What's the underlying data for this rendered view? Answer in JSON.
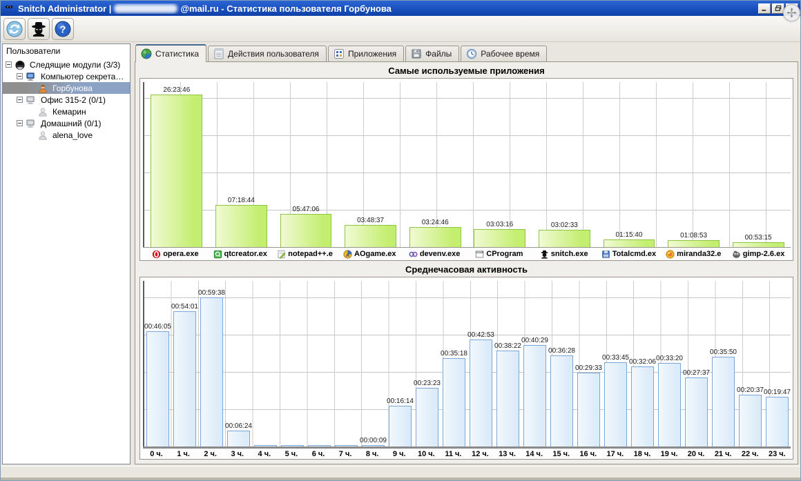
{
  "window": {
    "title_prefix": "Snitch Administrator |",
    "title_suffix": "@mail.ru - Статистика пользователя Горбунова",
    "controls": [
      {
        "name": "minimize"
      },
      {
        "name": "restore"
      },
      {
        "name": "close"
      }
    ]
  },
  "toolbar": {
    "buttons": [
      {
        "name": "refresh"
      },
      {
        "name": "spy"
      },
      {
        "name": "help"
      }
    ]
  },
  "sidebar": {
    "header": "Пользователи",
    "tree": [
      {
        "label": "Следящие модули (3/3)",
        "icon": "spy-node",
        "level": 0,
        "expandable": true,
        "selected": false,
        "enabled": true
      },
      {
        "label": "Компьютер секрета…",
        "icon": "computer",
        "level": 1,
        "expandable": true,
        "selected": false,
        "enabled": true
      },
      {
        "label": "Горбунова",
        "icon": "user",
        "level": 2,
        "expandable": false,
        "selected": true,
        "enabled": true
      },
      {
        "label": "Офис 315-2 (0/1)",
        "icon": "computer",
        "level": 1,
        "expandable": true,
        "selected": false,
        "enabled": false
      },
      {
        "label": "Кемарин",
        "icon": "user",
        "level": 2,
        "expandable": false,
        "selected": false,
        "enabled": false
      },
      {
        "label": "Домашний (0/1)",
        "icon": "computer",
        "level": 1,
        "expandable": true,
        "selected": false,
        "enabled": false
      },
      {
        "label": "alena_love",
        "icon": "user",
        "level": 2,
        "expandable": false,
        "selected": false,
        "enabled": false
      }
    ]
  },
  "tabs": [
    {
      "label": "Статистика",
      "icon": "pie",
      "active": true
    },
    {
      "label": "Действия пользователя",
      "icon": "list",
      "active": false
    },
    {
      "label": "Приложения",
      "icon": "grid",
      "active": false
    },
    {
      "label": "Файлы",
      "icon": "disk",
      "active": false
    },
    {
      "label": "Рабочее время",
      "icon": "clock",
      "active": false
    }
  ],
  "chart_data": [
    {
      "type": "bar",
      "title": "Самые используемые приложения",
      "categories": [
        "opera.exe",
        "qtcreator.ex",
        "notepad++.e",
        "AOgame.ex",
        "devenv.exe",
        "CProgram",
        "snitch.exe",
        "Totalcmd.ex",
        "miranda32.e",
        "gimp-2.6.ex"
      ],
      "icons": [
        "opera",
        "qt",
        "notepad",
        "aogame",
        "devenv",
        "cprogram",
        "snitch",
        "totalcmd",
        "miranda",
        "gimp"
      ],
      "values": [
        "26:23:46",
        "07:18:44",
        "05:47:06",
        "03:48:37",
        "03:24:46",
        "03:03:16",
        "03:02:33",
        "01:15:40",
        "01:08:53",
        "00:53:15"
      ],
      "value_unit": "HH:MM:SS",
      "xlabel": "",
      "ylabel": "",
      "grid": true,
      "bar_fill_light": "#f1fad4",
      "bar_fill_dark": "#c3ee6f",
      "bar_border": "#8dc63f"
    },
    {
      "type": "bar",
      "title": "Среднечасовая активность",
      "categories": [
        "0 ч.",
        "1 ч.",
        "2 ч.",
        "3 ч.",
        "4 ч.",
        "5 ч.",
        "6 ч.",
        "7 ч.",
        "8 ч.",
        "9 ч.",
        "10 ч.",
        "11 ч.",
        "12 ч.",
        "13 ч.",
        "14 ч.",
        "15 ч.",
        "16 ч.",
        "17 ч.",
        "18 ч.",
        "19 ч.",
        "20 ч.",
        "21 ч.",
        "22 ч.",
        "23 ч."
      ],
      "values": [
        "00:46:05",
        "00:54:01",
        "00:59:38",
        "00:06:24",
        "",
        "",
        "",
        "",
        "00:00:09",
        "00:16:14",
        "00:23:23",
        "00:35:18",
        "00:42:53",
        "00:38:22",
        "00:40:29",
        "00:36:28",
        "00:29:33",
        "00:33:45",
        "00:32:06",
        "00:33:20",
        "00:27:37",
        "00:35:50",
        "00:20:37",
        "00:19:47"
      ],
      "value_unit": "HH:MM:SS",
      "xlabel": "",
      "ylabel": "",
      "grid": true,
      "bar_fill_light": "#f2f8fd",
      "bar_fill_dark": "#dcebf9",
      "bar_border": "#7ca6d8"
    }
  ],
  "colors": {
    "titlebar_top": "#2c66d4",
    "titlebar_bottom": "#0f41a6",
    "selection_left": "#8f8f8f",
    "selection_right": "#8ca3c6",
    "green_bar": "#c3ee6f",
    "green_bar_border": "#8dc63f",
    "blue_bar": "#dcebf9",
    "blue_bar_border": "#7ca6d8"
  }
}
